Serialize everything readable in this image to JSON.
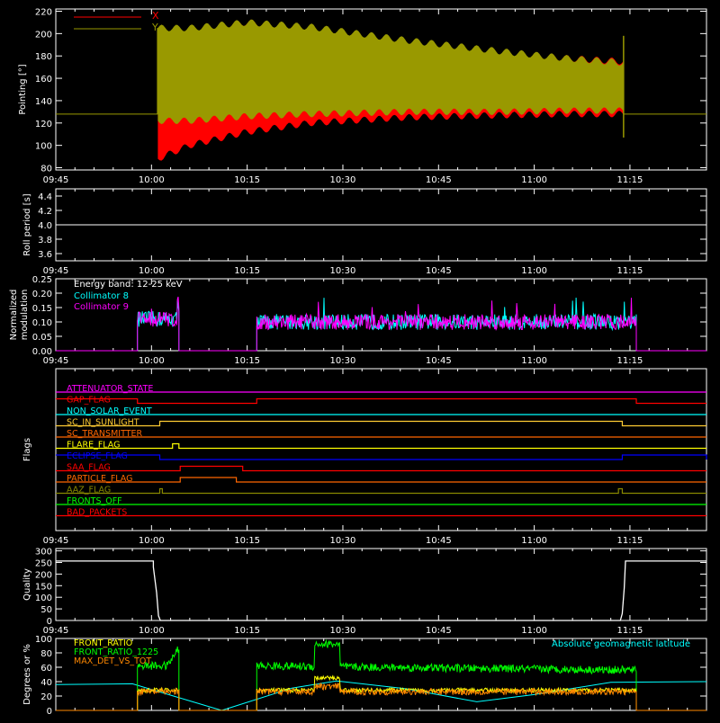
{
  "chart_data": [
    {
      "type": "line",
      "id": "pointing",
      "ylabel": "Pointing [°]",
      "ylim": [
        78,
        222
      ],
      "yticks": [
        80,
        100,
        120,
        140,
        160,
        180,
        200,
        220
      ],
      "xticks": [
        "09:45",
        "10:00",
        "10:15",
        "10:30",
        "10:45",
        "11:00",
        "11:15"
      ],
      "legend": [
        {
          "name": "X",
          "color": "#ff0000"
        },
        {
          "name": "Y",
          "color": "#999900"
        }
      ],
      "x_range_minutes": [
        585,
        687
      ],
      "baseline": 128,
      "envelope": {
        "start_minute": 601,
        "end_minute": 674,
        "x_upper": [
          [
            601,
            195
          ],
          [
            606,
            204
          ],
          [
            615,
            210
          ],
          [
            625,
            205
          ],
          [
            640,
            192
          ],
          [
            655,
            183
          ],
          [
            665,
            178
          ],
          [
            674,
            175
          ]
        ],
        "x_lower": [
          [
            601,
            88
          ],
          [
            606,
            100
          ],
          [
            615,
            112
          ],
          [
            625,
            120
          ],
          [
            640,
            125
          ],
          [
            655,
            127
          ],
          [
            665,
            128
          ],
          [
            674,
            128
          ]
        ],
        "y_upper": [
          [
            601,
            205
          ],
          [
            606,
            205
          ],
          [
            615,
            210
          ],
          [
            625,
            206
          ],
          [
            640,
            194
          ],
          [
            655,
            184
          ],
          [
            665,
            178
          ],
          [
            674,
            174
          ]
        ],
        "y_lower": [
          [
            601,
            122
          ],
          [
            606,
            122
          ],
          [
            615,
            126
          ],
          [
            625,
            128
          ],
          [
            640,
            130
          ],
          [
            655,
            130
          ],
          [
            665,
            131
          ],
          [
            674,
            131
          ]
        ]
      }
    },
    {
      "type": "line",
      "id": "roll",
      "ylabel": "Roll period [s]",
      "ylim": [
        3.5,
        4.5
      ],
      "yticks": [
        3.6,
        3.8,
        4.0,
        4.2,
        4.4
      ],
      "xticks": [
        "09:45",
        "10:00",
        "10:15",
        "10:30",
        "10:45",
        "11:00",
        "11:15"
      ],
      "x_range_minutes": [
        585,
        687
      ],
      "series": [
        {
          "color": "#ffffff",
          "points": [
            [
              585,
              4.0
            ],
            [
              687,
              4.0
            ]
          ]
        }
      ]
    },
    {
      "type": "line",
      "id": "modulation",
      "ylabel": "Normalized modulation",
      "ylim": [
        0,
        0.25
      ],
      "yticks": [
        0.0,
        0.05,
        0.1,
        0.15,
        0.2,
        0.25
      ],
      "xticks": [
        "09:45",
        "10:00",
        "10:15",
        "10:30",
        "10:45",
        "11:00",
        "11:15"
      ],
      "x_range_minutes": [
        585,
        687
      ],
      "annotation": "Energy band: 12-25 keV",
      "legend": [
        {
          "name": "Collimator 8",
          "color": "#00ffff"
        },
        {
          "name": "Collimator 9",
          "color": "#ff00ff"
        }
      ],
      "segments": [
        {
          "start": 597.8,
          "end": 604.3,
          "mean": 0.11
        },
        {
          "start": 616.5,
          "end": 676.0,
          "mean": 0.1
        }
      ]
    },
    {
      "type": "step",
      "id": "flags",
      "ylabel": "Flags",
      "xticks": [
        "09:45",
        "10:00",
        "10:15",
        "10:30",
        "10:45",
        "11:00",
        "11:15"
      ],
      "x_range_minutes": [
        585,
        687
      ],
      "flags": [
        {
          "name": "ATTENUATOR_STATE",
          "color": "#ff00ff",
          "on": []
        },
        {
          "name": "GAP_FLAG",
          "color": "#ff0000",
          "on": [
            [
              585,
              597.8
            ],
            [
              616.5,
              676
            ]
          ]
        },
        {
          "name": "NON_SOLAR_EVENT",
          "color": "#00ffff",
          "on": []
        },
        {
          "name": "SC_IN_SUNLIGHT",
          "color": "#ffcc33",
          "on": [
            [
              601.3,
              673.8
            ]
          ]
        },
        {
          "name": "SC_TRANSMITTER",
          "color": "#ff6600",
          "on": []
        },
        {
          "name": "FLARE_FLAG",
          "color": "#ffff00",
          "on": [
            [
              603.3,
              604.3
            ]
          ]
        },
        {
          "name": "ECLIPSE_FLAG",
          "color": "#0000ff",
          "on": [
            [
              585,
              601.3
            ],
            [
              673.8,
              687
            ]
          ]
        },
        {
          "name": "SAA_FLAG",
          "color": "#ff0000",
          "on": [
            [
              604.5,
              614.3
            ]
          ]
        },
        {
          "name": "PARTICLE_FLAG",
          "color": "#ff6600",
          "on": [
            [
              604.5,
              613.3
            ]
          ]
        },
        {
          "name": "AAZ_FLAG",
          "color": "#888800",
          "on": [
            [
              601.3,
              601.7
            ],
            [
              673.2,
              673.8
            ]
          ]
        },
        {
          "name": "FRONTS_OFF",
          "color": "#00ff00",
          "on": []
        },
        {
          "name": "BAD_PACKETS",
          "color": "#ff0000",
          "on": []
        }
      ]
    },
    {
      "type": "line",
      "id": "quality",
      "ylabel": "Quality",
      "ylim": [
        0,
        310
      ],
      "yticks": [
        0,
        50,
        100,
        150,
        200,
        250,
        300
      ],
      "xticks": [
        "09:45",
        "10:00",
        "10:15",
        "10:30",
        "10:45",
        "11:00",
        "11:15"
      ],
      "x_range_minutes": [
        585,
        687
      ],
      "series": [
        {
          "color": "#ffffff",
          "points": [
            [
              585,
              256
            ],
            [
              600.3,
              256
            ],
            [
              600.3,
              230
            ],
            [
              600.8,
              120
            ],
            [
              601.1,
              20
            ],
            [
              601.4,
              0
            ],
            [
              673.5,
              0
            ],
            [
              673.8,
              30
            ],
            [
              674.1,
              140
            ],
            [
              674.3,
              256
            ],
            [
              687,
              256
            ]
          ]
        }
      ]
    },
    {
      "type": "line",
      "id": "ratio",
      "ylabel": "Degrees or %",
      "ylim": [
        0,
        100
      ],
      "yticks": [
        0,
        20,
        40,
        60,
        80,
        100
      ],
      "x_range_minutes": [
        585,
        687
      ],
      "legend": [
        {
          "name": "FRONT_RATIO",
          "color": "#ffff00"
        },
        {
          "name": "FRONT_RATIO_1225",
          "color": "#00ff00"
        },
        {
          "name": "MAX_DET_VS_TOT",
          "color": "#ff8800"
        }
      ],
      "annotation": "Absolute geomagnetic latitude",
      "annotation_color": "#00ffff",
      "latitude": [
        [
          585,
          36
        ],
        [
          597,
          37
        ],
        [
          608,
          8
        ],
        [
          611,
          0
        ],
        [
          622,
          31
        ],
        [
          629,
          41
        ],
        [
          640,
          30
        ],
        [
          651,
          12
        ],
        [
          660,
          22
        ],
        [
          672,
          39
        ],
        [
          687,
          40
        ]
      ],
      "segments": [
        {
          "start": 597.8,
          "end": 604.3
        },
        {
          "start": 616.5,
          "end": 676.0
        }
      ]
    }
  ]
}
